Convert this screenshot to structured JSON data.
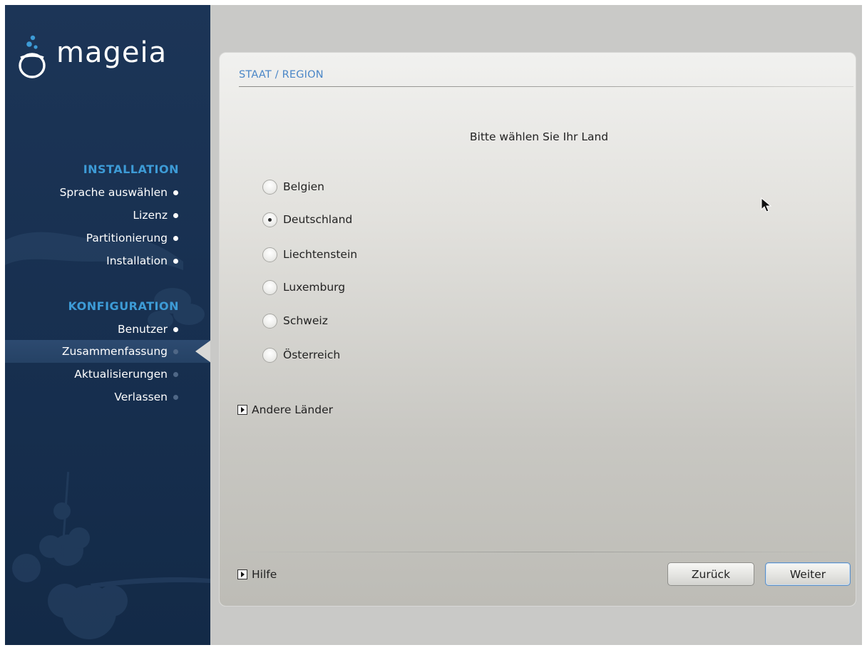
{
  "sidebar": {
    "logo_text": "mageia",
    "groups": [
      {
        "label": "INSTALLATION"
      },
      {
        "label": "KONFIGURATION"
      }
    ],
    "steps": [
      {
        "label": "Sprache auswählen",
        "state": "done"
      },
      {
        "label": "Lizenz",
        "state": "done"
      },
      {
        "label": "Partitionierung",
        "state": "done"
      },
      {
        "label": "Installation",
        "state": "done"
      },
      {
        "label": "Benutzer",
        "state": "done"
      },
      {
        "label": "Zusammenfassung",
        "state": "active"
      },
      {
        "label": "Aktualisierungen",
        "state": "pending"
      },
      {
        "label": "Verlassen",
        "state": "pending"
      }
    ]
  },
  "panel": {
    "title": "STAAT / REGION",
    "prompt": "Bitte wählen Sie Ihr Land",
    "countries": [
      {
        "label": "Belgien",
        "selected": false
      },
      {
        "label": "Deutschland",
        "selected": true
      },
      {
        "label": "Liechtenstein",
        "selected": false
      },
      {
        "label": "Luxemburg",
        "selected": false
      },
      {
        "label": "Schweiz",
        "selected": false
      },
      {
        "label": "Österreich",
        "selected": false
      }
    ],
    "other_countries_label": "Andere Länder",
    "help_label": "Hilfe",
    "back_label": "Zurück",
    "next_label": "Weiter"
  },
  "colors": {
    "sidebar_bg": "#1c3557",
    "sidebar_group": "#3d9bd6",
    "title_blue": "#4a86c7",
    "frame_bg": "#c9c9c7"
  }
}
